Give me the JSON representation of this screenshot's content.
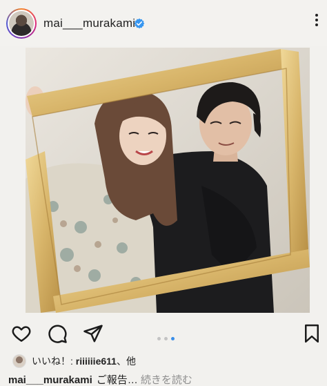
{
  "header": {
    "username": "mai___murakami",
    "verified": true,
    "icons": {
      "avatar": "story-ring-avatar",
      "verified": "verified-badge-icon",
      "more": "more-options-icon"
    }
  },
  "post": {
    "image_description_icon": "photo-frame-couple",
    "carousel": {
      "count": 3,
      "active": 3
    }
  },
  "actions": {
    "icons": [
      "heart-icon",
      "comment-icon",
      "share-icon",
      "bookmark-icon"
    ]
  },
  "likes": {
    "prefix": "いいね！: ",
    "user": "riiiiiie611",
    "suffix": "、他"
  },
  "caption": {
    "user": "mai___murakami",
    "text": "ご報告… ",
    "more": "続きを読む"
  },
  "colors": {
    "accent_dot": "#3a8ee8",
    "verified_blue": "#3897f0",
    "frame_gold": "#d8b56a"
  }
}
